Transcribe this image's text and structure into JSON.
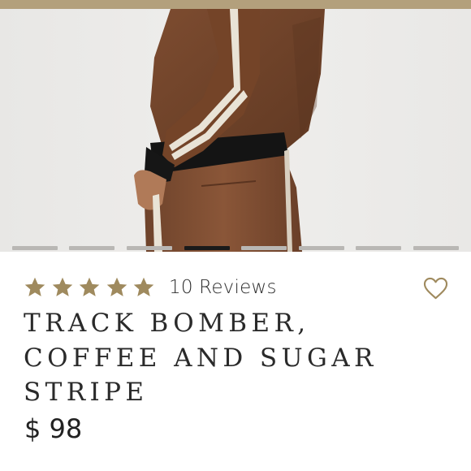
{
  "colors": {
    "accent_gold": "#b3a07c",
    "star_color": "#9f8a5e",
    "jacket_brown": "#7a4a2e",
    "active_dot": "#1a1a1a"
  },
  "gallery": {
    "image_alt": "product-photo",
    "slide_count": 8,
    "active_slide": 4
  },
  "product": {
    "rating": 5,
    "reviews_label": "10 Reviews",
    "title": "TRACK BOMBER, COFFEE AND SUGAR STRIPE",
    "price": "$ 98"
  },
  "icons": {
    "star": "star-icon",
    "wishlist": "heart-outline-icon"
  }
}
